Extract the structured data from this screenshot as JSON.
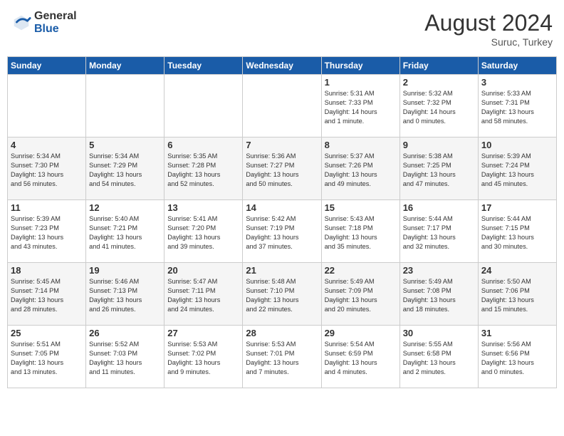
{
  "logo": {
    "general": "General",
    "blue": "Blue"
  },
  "header": {
    "month": "August 2024",
    "location": "Suruc, Turkey"
  },
  "weekdays": [
    "Sunday",
    "Monday",
    "Tuesday",
    "Wednesday",
    "Thursday",
    "Friday",
    "Saturday"
  ],
  "weeks": [
    [
      {
        "day": "",
        "info": ""
      },
      {
        "day": "",
        "info": ""
      },
      {
        "day": "",
        "info": ""
      },
      {
        "day": "",
        "info": ""
      },
      {
        "day": "1",
        "info": "Sunrise: 5:31 AM\nSunset: 7:33 PM\nDaylight: 14 hours\nand 1 minute."
      },
      {
        "day": "2",
        "info": "Sunrise: 5:32 AM\nSunset: 7:32 PM\nDaylight: 14 hours\nand 0 minutes."
      },
      {
        "day": "3",
        "info": "Sunrise: 5:33 AM\nSunset: 7:31 PM\nDaylight: 13 hours\nand 58 minutes."
      }
    ],
    [
      {
        "day": "4",
        "info": "Sunrise: 5:34 AM\nSunset: 7:30 PM\nDaylight: 13 hours\nand 56 minutes."
      },
      {
        "day": "5",
        "info": "Sunrise: 5:34 AM\nSunset: 7:29 PM\nDaylight: 13 hours\nand 54 minutes."
      },
      {
        "day": "6",
        "info": "Sunrise: 5:35 AM\nSunset: 7:28 PM\nDaylight: 13 hours\nand 52 minutes."
      },
      {
        "day": "7",
        "info": "Sunrise: 5:36 AM\nSunset: 7:27 PM\nDaylight: 13 hours\nand 50 minutes."
      },
      {
        "day": "8",
        "info": "Sunrise: 5:37 AM\nSunset: 7:26 PM\nDaylight: 13 hours\nand 49 minutes."
      },
      {
        "day": "9",
        "info": "Sunrise: 5:38 AM\nSunset: 7:25 PM\nDaylight: 13 hours\nand 47 minutes."
      },
      {
        "day": "10",
        "info": "Sunrise: 5:39 AM\nSunset: 7:24 PM\nDaylight: 13 hours\nand 45 minutes."
      }
    ],
    [
      {
        "day": "11",
        "info": "Sunrise: 5:39 AM\nSunset: 7:23 PM\nDaylight: 13 hours\nand 43 minutes."
      },
      {
        "day": "12",
        "info": "Sunrise: 5:40 AM\nSunset: 7:21 PM\nDaylight: 13 hours\nand 41 minutes."
      },
      {
        "day": "13",
        "info": "Sunrise: 5:41 AM\nSunset: 7:20 PM\nDaylight: 13 hours\nand 39 minutes."
      },
      {
        "day": "14",
        "info": "Sunrise: 5:42 AM\nSunset: 7:19 PM\nDaylight: 13 hours\nand 37 minutes."
      },
      {
        "day": "15",
        "info": "Sunrise: 5:43 AM\nSunset: 7:18 PM\nDaylight: 13 hours\nand 35 minutes."
      },
      {
        "day": "16",
        "info": "Sunrise: 5:44 AM\nSunset: 7:17 PM\nDaylight: 13 hours\nand 32 minutes."
      },
      {
        "day": "17",
        "info": "Sunrise: 5:44 AM\nSunset: 7:15 PM\nDaylight: 13 hours\nand 30 minutes."
      }
    ],
    [
      {
        "day": "18",
        "info": "Sunrise: 5:45 AM\nSunset: 7:14 PM\nDaylight: 13 hours\nand 28 minutes."
      },
      {
        "day": "19",
        "info": "Sunrise: 5:46 AM\nSunset: 7:13 PM\nDaylight: 13 hours\nand 26 minutes."
      },
      {
        "day": "20",
        "info": "Sunrise: 5:47 AM\nSunset: 7:11 PM\nDaylight: 13 hours\nand 24 minutes."
      },
      {
        "day": "21",
        "info": "Sunrise: 5:48 AM\nSunset: 7:10 PM\nDaylight: 13 hours\nand 22 minutes."
      },
      {
        "day": "22",
        "info": "Sunrise: 5:49 AM\nSunset: 7:09 PM\nDaylight: 13 hours\nand 20 minutes."
      },
      {
        "day": "23",
        "info": "Sunrise: 5:49 AM\nSunset: 7:08 PM\nDaylight: 13 hours\nand 18 minutes."
      },
      {
        "day": "24",
        "info": "Sunrise: 5:50 AM\nSunset: 7:06 PM\nDaylight: 13 hours\nand 15 minutes."
      }
    ],
    [
      {
        "day": "25",
        "info": "Sunrise: 5:51 AM\nSunset: 7:05 PM\nDaylight: 13 hours\nand 13 minutes."
      },
      {
        "day": "26",
        "info": "Sunrise: 5:52 AM\nSunset: 7:03 PM\nDaylight: 13 hours\nand 11 minutes."
      },
      {
        "day": "27",
        "info": "Sunrise: 5:53 AM\nSunset: 7:02 PM\nDaylight: 13 hours\nand 9 minutes."
      },
      {
        "day": "28",
        "info": "Sunrise: 5:53 AM\nSunset: 7:01 PM\nDaylight: 13 hours\nand 7 minutes."
      },
      {
        "day": "29",
        "info": "Sunrise: 5:54 AM\nSunset: 6:59 PM\nDaylight: 13 hours\nand 4 minutes."
      },
      {
        "day": "30",
        "info": "Sunrise: 5:55 AM\nSunset: 6:58 PM\nDaylight: 13 hours\nand 2 minutes."
      },
      {
        "day": "31",
        "info": "Sunrise: 5:56 AM\nSunset: 6:56 PM\nDaylight: 13 hours\nand 0 minutes."
      }
    ]
  ]
}
